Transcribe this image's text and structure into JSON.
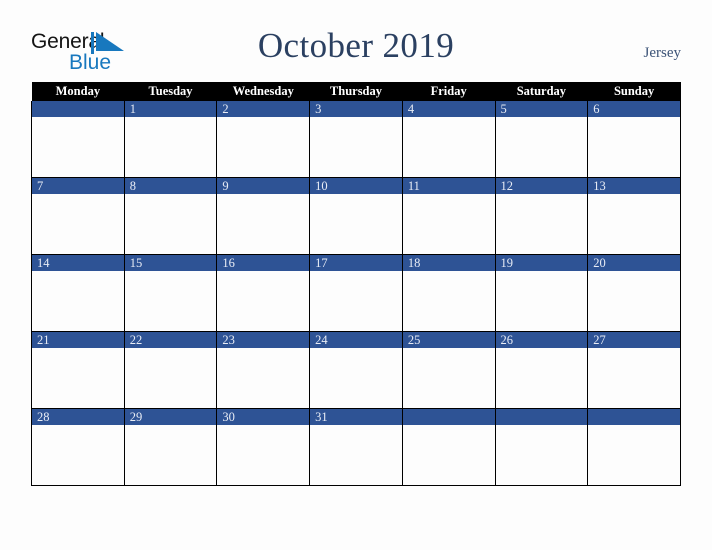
{
  "brand": {
    "name_part1": "General",
    "name_part2": "Blue",
    "triangle_color": "#1878be",
    "text_color": "#141414"
  },
  "header": {
    "title": "October 2019",
    "region": "Jersey",
    "title_color": "#2b4061"
  },
  "calendar": {
    "weekday_headers": [
      "Monday",
      "Tuesday",
      "Wednesday",
      "Thursday",
      "Friday",
      "Saturday",
      "Sunday"
    ],
    "header_bg": "#000000",
    "header_text": "#ffffff",
    "date_bar_bg": "#2e5395",
    "date_text": "#e8ecf5",
    "cell_bg": "#fdfdfd",
    "grid_line": "#000000",
    "weeks": [
      [
        "",
        "1",
        "2",
        "3",
        "4",
        "5",
        "6"
      ],
      [
        "7",
        "8",
        "9",
        "10",
        "11",
        "12",
        "13"
      ],
      [
        "14",
        "15",
        "16",
        "17",
        "18",
        "19",
        "20"
      ],
      [
        "21",
        "22",
        "23",
        "24",
        "25",
        "26",
        "27"
      ],
      [
        "28",
        "29",
        "30",
        "31",
        "",
        "",
        ""
      ]
    ]
  }
}
